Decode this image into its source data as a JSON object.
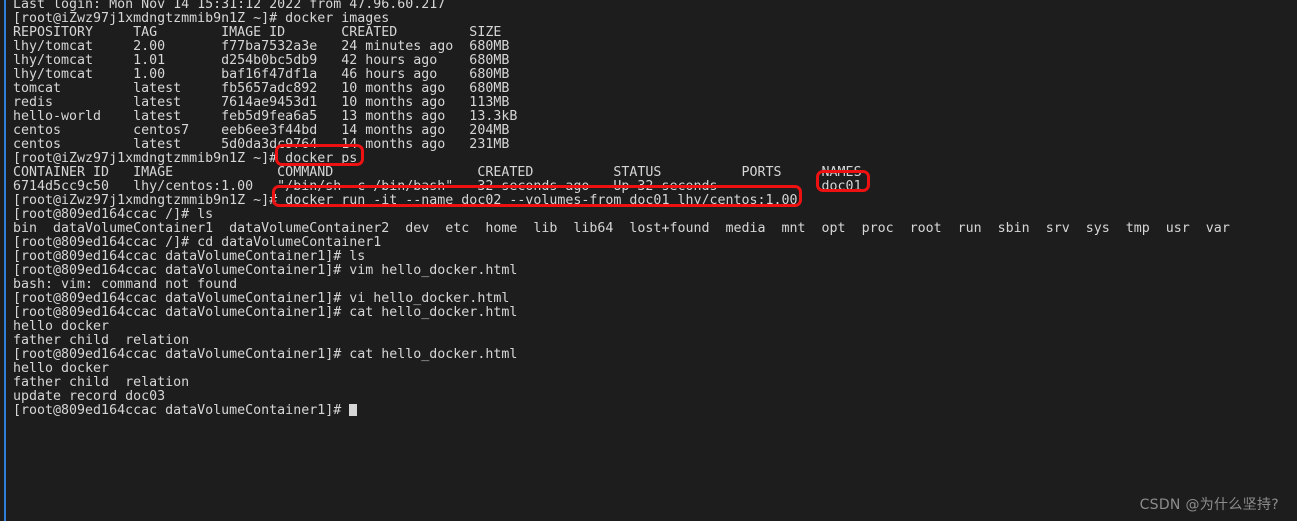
{
  "terminal": {
    "background_color": "#1d1d1d",
    "foreground_color": "#d6d6d6",
    "accent_rule_color": "#2f80d8",
    "highlight_color": "#ee1111",
    "lines": [
      "Last login: Mon Nov 14 15:31:12 2022 from 47.96.60.217",
      "[root@iZwz97j1xmdngtzmmib9n1Z ~]# docker images",
      "REPOSITORY     TAG        IMAGE ID       CREATED         SIZE",
      "lhy/tomcat     2.00       f77ba7532a3e   24 minutes ago  680MB",
      "lhy/tomcat     1.01       d254b0bc5db9   42 hours ago    680MB",
      "lhy/tomcat     1.00       baf16f47df1a   46 hours ago    680MB",
      "tomcat         latest     fb5657adc892   10 months ago   680MB",
      "redis          latest     7614ae9453d1   10 months ago   113MB",
      "hello-world    latest     feb5d9fea6a5   13 months ago   13.3kB",
      "centos         centos7    eeb6ee3f44bd   14 months ago   204MB",
      "centos         latest     5d0da3dc9764   14 months ago   231MB",
      "[root@iZwz97j1xmdngtzmmib9n1Z ~]# docker ps",
      "CONTAINER ID   IMAGE             COMMAND                  CREATED          STATUS          PORTS     NAMES",
      "6714d5cc9c50   lhy/centos:1.00   \"/bin/sh -c /bin/bash\"   32 seconds ago   Up 32 seconds             doc01",
      "[root@iZwz97j1xmdngtzmmib9n1Z ~]# docker run -it --name doc02 --volumes-from doc01 lhy/centos:1.00",
      "[root@809ed164ccac /]# ls",
      "bin  dataVolumeContainer1  dataVolumeContainer2  dev  etc  home  lib  lib64  lost+found  media  mnt  opt  proc  root  run  sbin  srv  sys  tmp  usr  var",
      "[root@809ed164ccac /]# cd dataVolumeContainer1",
      "[root@809ed164ccac dataVolumeContainer1]# ls",
      "[root@809ed164ccac dataVolumeContainer1]# vim hello_docker.html",
      "bash: vim: command not found",
      "[root@809ed164ccac dataVolumeContainer1]# vi hello_docker.html",
      "[root@809ed164ccac dataVolumeContainer1]# cat hello_docker.html",
      "hello docker",
      "father child  relation",
      "[root@809ed164ccac dataVolumeContainer1]# cat hello_docker.html",
      "hello docker",
      "father child  relation",
      "update record doc03",
      "[root@809ed164ccac dataVolumeContainer1]# "
    ],
    "prompt_cursor": "block"
  },
  "annotations": {
    "docker_ps": "docker ps",
    "names_doc01": "doc01",
    "run_command": "docker run -it --name doc02 --volumes-from doc01 lhy/centos:1.00"
  },
  "watermark": {
    "text": "CSDN @为什么坚持?"
  }
}
